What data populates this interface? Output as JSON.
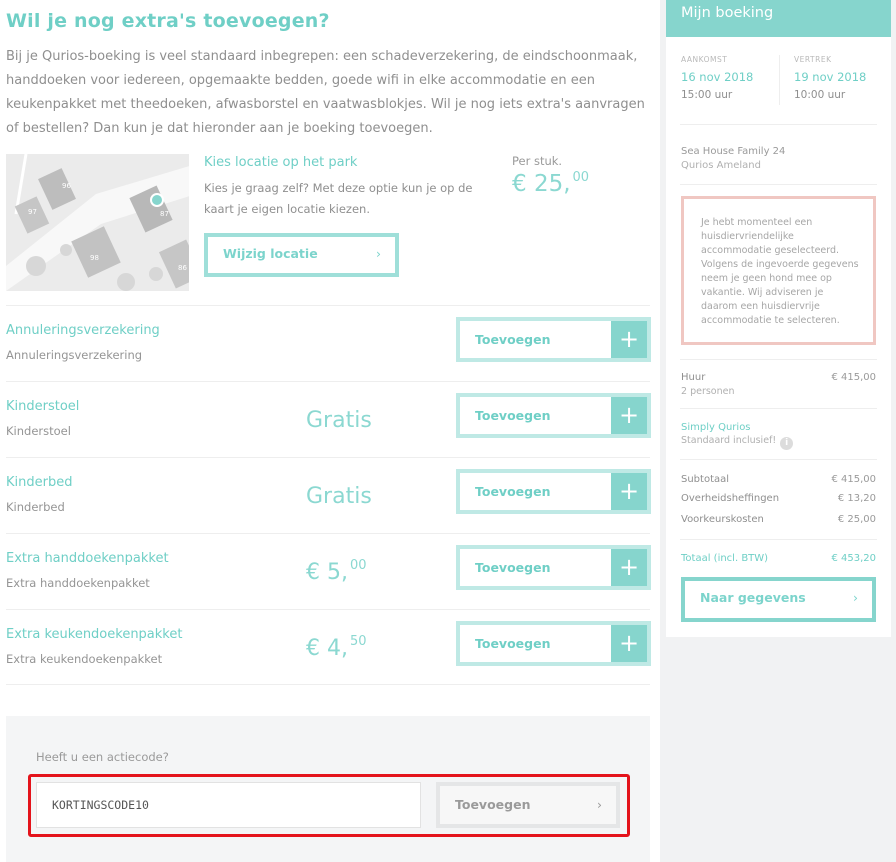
{
  "main": {
    "title": "Wil je nog extra's toevoegen?",
    "intro": "Bij je Qurios-boeking is veel standaard inbegrepen: een schadeverzekering, de eindschoonmaak, handdoeken voor iedereen, opgemaakte bedden, goede wifi in elke accommodatie en een keukenpakket met theedoeken, afwasborstel en vaatwasblokjes. Wil je nog iets extra's aanvragen of bestellen? Dan kun je dat hieronder aan je boeking toevoegen."
  },
  "location": {
    "title": "Kies locatie op het park",
    "description": "Kies je graag zelf? Met deze optie kun je op de kaart je eigen locatie kiezen.",
    "per_label": "Per stuk.",
    "price_main": "€ 25,",
    "price_cents": "00",
    "button_label": "Wijzig locatie",
    "map_labels": [
      "96",
      "97",
      "87",
      "98",
      "86"
    ]
  },
  "extras": [
    {
      "name": "Annuleringsverzekering",
      "sub": "Annuleringsverzekering",
      "price_main": "",
      "price_cents": "",
      "button_label": "Toevoegen"
    },
    {
      "name": "Kinderstoel",
      "sub": "Kinderstoel",
      "price_main": "Gratis",
      "price_cents": "",
      "button_label": "Toevoegen"
    },
    {
      "name": "Kinderbed",
      "sub": "Kinderbed",
      "price_main": "Gratis",
      "price_cents": "",
      "button_label": "Toevoegen"
    },
    {
      "name": "Extra handdoekenpakket",
      "sub": "Extra handdoekenpakket",
      "price_main": "€ 5,",
      "price_cents": "00",
      "button_label": "Toevoegen"
    },
    {
      "name": "Extra keukendoekenpakket",
      "sub": "Extra keukendoekenpakket",
      "price_main": "€ 4,",
      "price_cents": "50",
      "button_label": "Toevoegen"
    }
  ],
  "promo": {
    "label": "Heeft u een actiecode?",
    "value": "KORTINGSCODE10",
    "button_label": "Toevoegen"
  },
  "sidebar": {
    "title": "Mijn boeking",
    "arrival": {
      "label": "Aankomst",
      "date": "16 nov 2018",
      "time": "15:00 uur"
    },
    "departure": {
      "label": "Vertrek",
      "date": "19 nov 2018",
      "time": "10:00 uur"
    },
    "accommodation": "Sea House Family 24",
    "park": "Qurios Ameland",
    "warning": "Je hebt momenteel een huisdiervriendelijke accommodatie geselecteerd. Volgens de ingevoerde gegevens neem je geen hond mee op vakantie. Wij adviseren je daarom een huisdiervrije accommodatie te selecteren.",
    "rent": {
      "label": "Huur",
      "sub": "2 personen",
      "amount": "€ 415,00"
    },
    "simply": {
      "label": "Simply Qurios",
      "sub": "Standaard inclusief!"
    },
    "subtotal": {
      "label": "Subtotaal",
      "amount": "€ 415,00"
    },
    "taxes": {
      "label": "Overheidsheffingen",
      "amount": "€ 13,20"
    },
    "preference": {
      "label": "Voorkeurskosten",
      "amount": "€ 25,00"
    },
    "total": {
      "label": "Totaal (incl. BTW)",
      "amount": "€ 453,20"
    },
    "next_button": "Naar gegevens"
  },
  "colors": {
    "accent": "#86d5cd",
    "accent_text": "#6fcfc6",
    "warning_border": "#f0c7c2",
    "highlight": "#e4131b"
  }
}
